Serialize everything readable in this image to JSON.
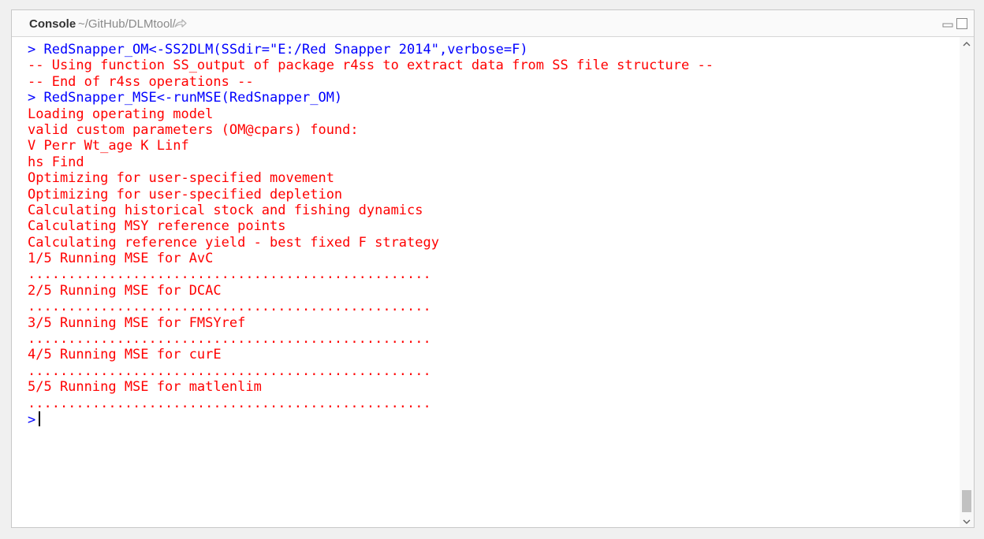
{
  "header": {
    "title": "Console",
    "path": "~/GitHub/DLMtool/"
  },
  "icons": {
    "goto_directory": "arrow-right-icon",
    "minimize": "minimize-icon",
    "maximize": "maximize-icon"
  },
  "colors": {
    "input_text": "#0000ff",
    "output_text": "#ff0000",
    "title_text": "#333333",
    "path_text": "#8a8a8a"
  },
  "console": {
    "lines": [
      {
        "type": "input",
        "text": "> RedSnapper_OM<-SS2DLM(SSdir=\"E:/Red Snapper 2014\",verbose=F)"
      },
      {
        "type": "output",
        "text": "-- Using function SS_output of package r4ss to extract data from SS file structure --"
      },
      {
        "type": "output",
        "text": "-- End of r4ss operations --"
      },
      {
        "type": "input",
        "text": "> RedSnapper_MSE<-runMSE(RedSnapper_OM)"
      },
      {
        "type": "output",
        "text": "Loading operating model"
      },
      {
        "type": "output",
        "text": "valid custom parameters (OM@cpars) found:"
      },
      {
        "type": "output",
        "text": "V Perr Wt_age K Linf"
      },
      {
        "type": "output",
        "text": "hs Find"
      },
      {
        "type": "output",
        "text": "Optimizing for user-specified movement"
      },
      {
        "type": "output",
        "text": "Optimizing for user-specified depletion"
      },
      {
        "type": "output",
        "text": "Calculating historical stock and fishing dynamics"
      },
      {
        "type": "output",
        "text": "Calculating MSY reference points"
      },
      {
        "type": "output",
        "text": "Calculating reference yield - best fixed F strategy"
      },
      {
        "type": "output",
        "text": "1/5 Running MSE for AvC"
      },
      {
        "type": "output",
        "text": ".................................................."
      },
      {
        "type": "output",
        "text": "2/5 Running MSE for DCAC"
      },
      {
        "type": "output",
        "text": ".................................................."
      },
      {
        "type": "output",
        "text": "3/5 Running MSE for FMSYref"
      },
      {
        "type": "output",
        "text": ".................................................."
      },
      {
        "type": "output",
        "text": "4/5 Running MSE for curE"
      },
      {
        "type": "output",
        "text": ".................................................."
      },
      {
        "type": "output",
        "text": "5/5 Running MSE for matlenlim"
      },
      {
        "type": "output",
        "text": ".................................................."
      }
    ],
    "prompt": ">"
  }
}
